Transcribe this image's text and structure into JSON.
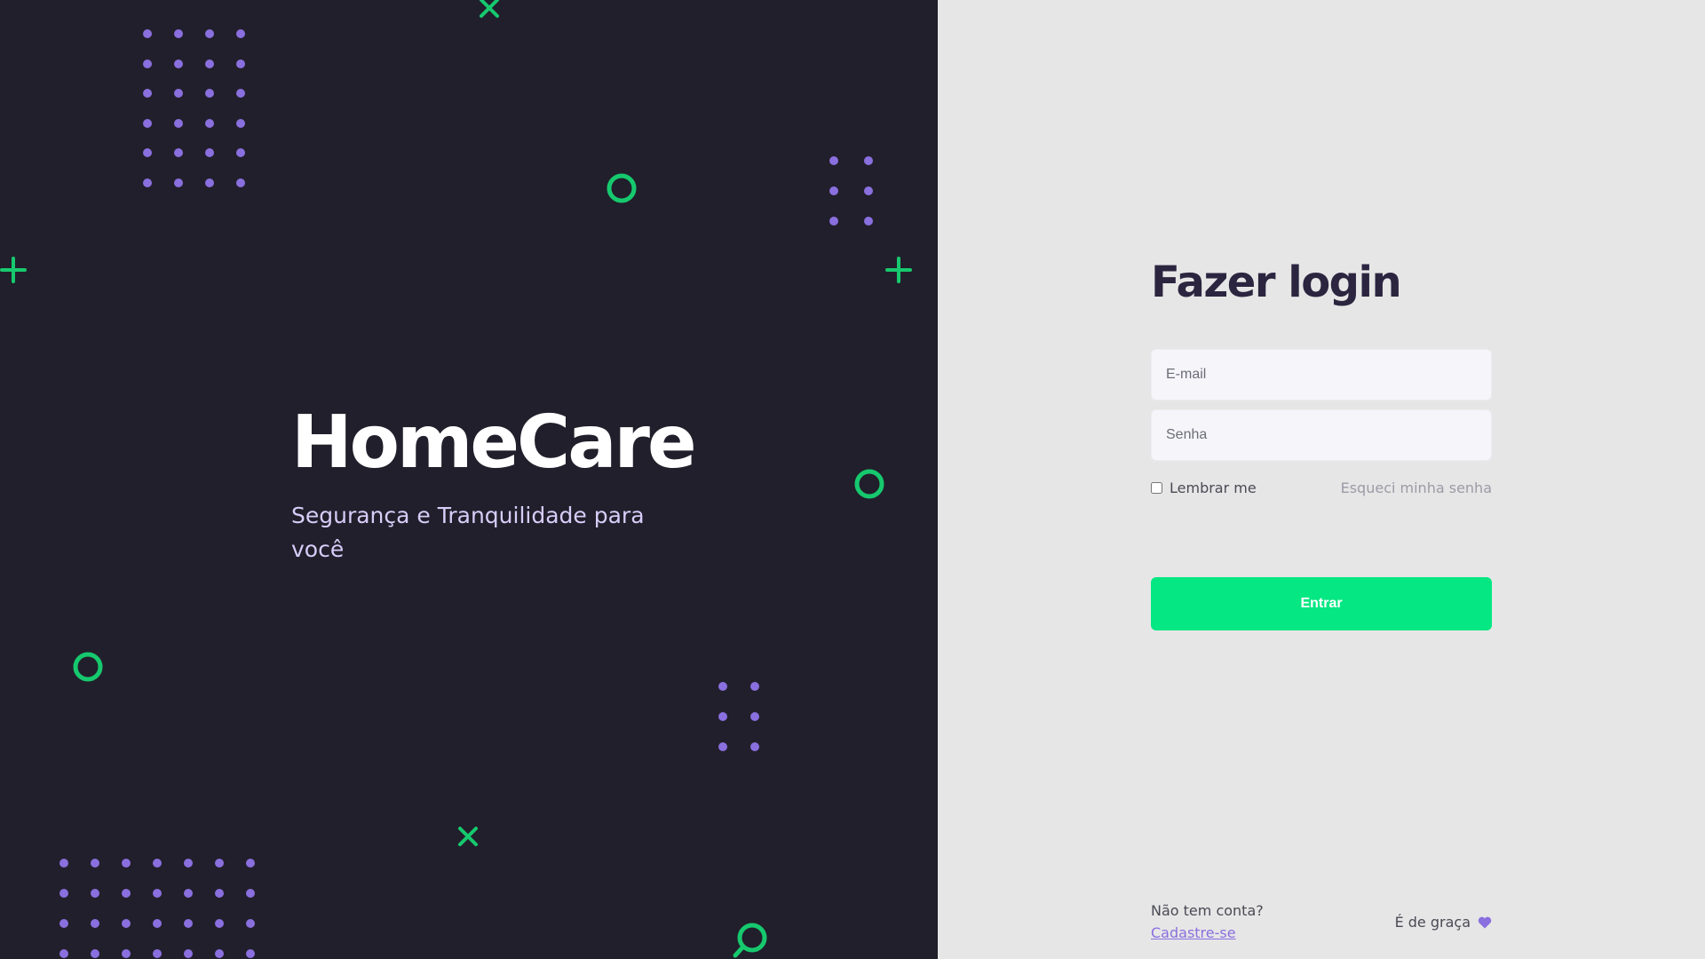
{
  "hero": {
    "title": "HomeCare",
    "tagline": "Segurança e Tranquilidade para você"
  },
  "login": {
    "title": "Fazer login",
    "email_placeholder": "E-mail",
    "password_placeholder": "Senha",
    "remember_label": "Lembrar me",
    "forgot_label": "Esqueci minha senha",
    "submit_label": "Entrar",
    "signup_prompt": "Não tem conta?",
    "signup_link": "Cadastre-se",
    "free_label": "É de graça"
  },
  "colors": {
    "hero_bg": "#211f2b",
    "panel_bg": "#e6e6e6",
    "accent_green": "#04e783",
    "accent_purple": "#8a6fdf",
    "title_text": "#2b2540"
  },
  "icons": [
    "plus-icon",
    "x-icon",
    "circle-icon",
    "search-icon",
    "heart-icon"
  ]
}
